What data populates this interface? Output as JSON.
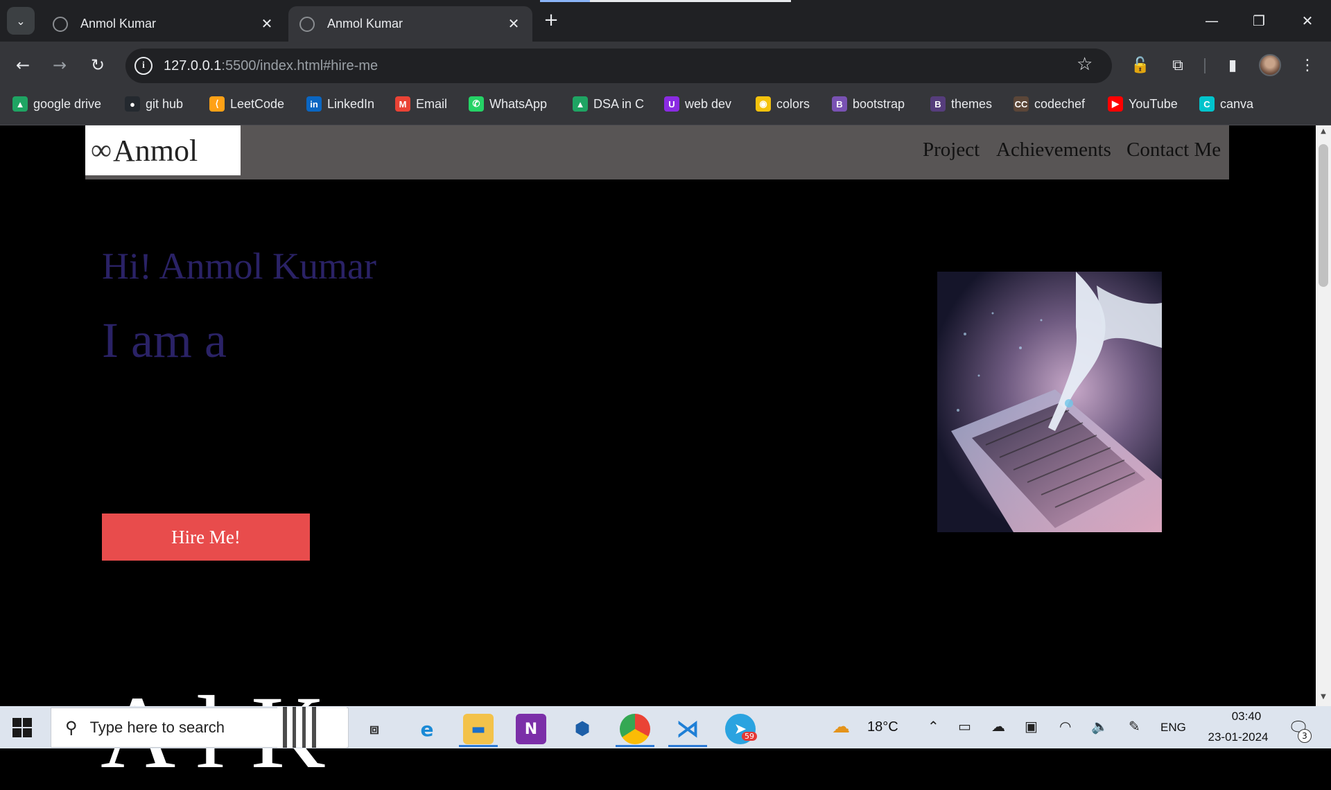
{
  "browser": {
    "tabs": [
      {
        "title": "Anmol Kumar",
        "active": false
      },
      {
        "title": "Anmol Kumar",
        "active": true
      }
    ],
    "url_host": "127.0.0.1",
    "url_rest": ":5500/index.html#hire-me",
    "bookmarks": [
      {
        "label": "google drive",
        "icon": "google-drive-icon",
        "color": "#1fa463"
      },
      {
        "label": "git hub",
        "icon": "github-icon",
        "color": "#24292f"
      },
      {
        "label": "LeetCode",
        "icon": "leetcode-icon",
        "color": "#ffa116"
      },
      {
        "label": "LinkedIn",
        "icon": "linkedin-icon",
        "color": "#0a66c2"
      },
      {
        "label": "Email",
        "icon": "gmail-icon",
        "color": "#ea4335"
      },
      {
        "label": "WhatsApp",
        "icon": "whatsapp-icon",
        "color": "#25d366"
      },
      {
        "label": "DSA in C",
        "icon": "google-drive-icon",
        "color": "#1fa463"
      },
      {
        "label": "web dev",
        "icon": "web-dev-icon",
        "color": "#8a2be2"
      },
      {
        "label": "colors",
        "icon": "colors-icon",
        "color": "#f4c20d"
      },
      {
        "label": "bootstrap",
        "icon": "bootstrap-icon",
        "color": "#7952b3"
      },
      {
        "label": "themes",
        "icon": "bootstrap-icon",
        "color": "#563d7c"
      },
      {
        "label": "codechef",
        "icon": "codechef-icon",
        "color": "#5b4638"
      },
      {
        "label": "YouTube",
        "icon": "youtube-icon",
        "color": "#ff0000"
      },
      {
        "label": "canva",
        "icon": "canva-icon",
        "color": "#00c4cc"
      }
    ]
  },
  "site": {
    "brand": "Anmol",
    "brand_symbol": "∞",
    "nav": [
      "Project",
      "Achievements",
      "Contact Me"
    ],
    "greeting": "Hi! Anmol Kumar",
    "intro": "I am a",
    "hire_button": "Hire Me!",
    "bottom_heading_partial": "A        l K"
  },
  "taskbar": {
    "search_placeholder": "Type here to search",
    "temperature": "18°C",
    "language": "ENG",
    "time": "03:40",
    "date": "23-01-2024",
    "notification_count": "3",
    "telegram_badge": "59"
  }
}
